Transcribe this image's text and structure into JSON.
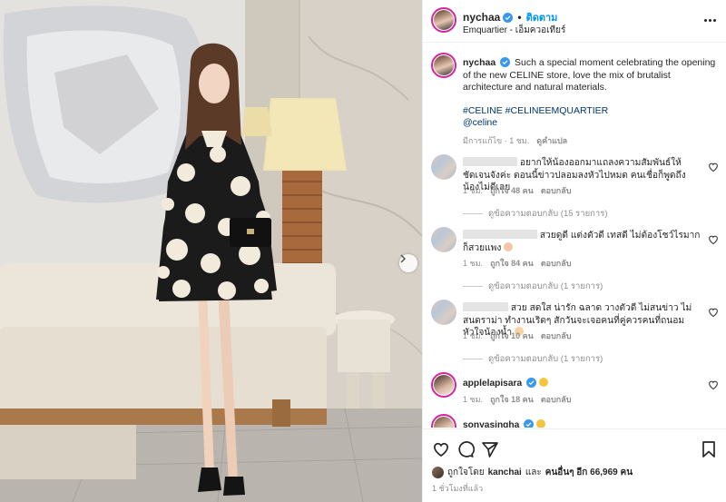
{
  "post": {
    "username": "nychaa",
    "follow_label": "ติดตาม",
    "location": "Emquartier - เอ็มควอเทียร์",
    "caption_user": "nychaa",
    "caption_text": "Such a special moment celebrating the opening of the new CELINE store, love the mix of brutalist architecture and natural materials.",
    "hashtags": "#CELINE #CELINEEMQUARTIER",
    "mention": "@celine",
    "caption_meta_edited": "มีการแก้ไข · 1 ชม.",
    "caption_meta_translate": "ดูคำแปล"
  },
  "comments": [
    {
      "text": "อยากให้น้องออกมาแถลงความสัมพันธ์ให้ชัดเจนจังค่ะ ตอนนี้ข่าวปลอมลงหัวไปหมด คนเชื่อก็พูดถึงน้องไม่ดีเลย",
      "time": "1 ชม.",
      "likes": "ถูกใจ 48 คน",
      "reply": "ตอบกลับ",
      "view_replies": "ดูข้อความตอบกลับ (15 รายการ)"
    },
    {
      "text": "สวยดูดี แต่งตัวดี เทสดี ไม่ต้องโชว์ไรมาก ก็สวยแพง",
      "time": "1 ชม.",
      "likes": "ถูกใจ 84 คน",
      "reply": "ตอบกลับ",
      "view_replies": "ดูข้อความตอบกลับ (1 รายการ)"
    },
    {
      "text": "สวย สดใส น่ารัก ฉลาด วางตัวดี ไม่สนข่าว ไม่สนดราม่า ทำงานเริดๆ สักวันจะเจอคนที่คู่ควรคนที่ถนอมหัวใจน้องน้ำ",
      "time": "1 ชม.",
      "likes": "ถูกใจ 10 คน",
      "reply": "ตอบกลับ",
      "view_replies": "ดูข้อความตอบกลับ (1 รายการ)"
    },
    {
      "user": "applelapisara",
      "time": "1 ชม.",
      "likes": "ถูกใจ 18 คน",
      "reply": "ตอบกลับ"
    },
    {
      "user": "sonyasingha"
    }
  ],
  "likes_summary": {
    "prefix": "ถูกใจโดย",
    "liker": "kanchai",
    "middle": "และ",
    "others": "คนอื่นๆ อีก 66,969 คน"
  },
  "time_ago": "1 ชั่วโมงที่แล้ว",
  "icons": {
    "like": "heart-icon",
    "comment": "comment-icon",
    "share": "share-icon",
    "save": "bookmark-icon",
    "more": "more-options-icon",
    "next": "chevron-right-icon"
  },
  "colors": {
    "link": "#00376b",
    "follow": "#0095f6",
    "verified": "#3897f0",
    "muted": "#8e8e8e"
  }
}
